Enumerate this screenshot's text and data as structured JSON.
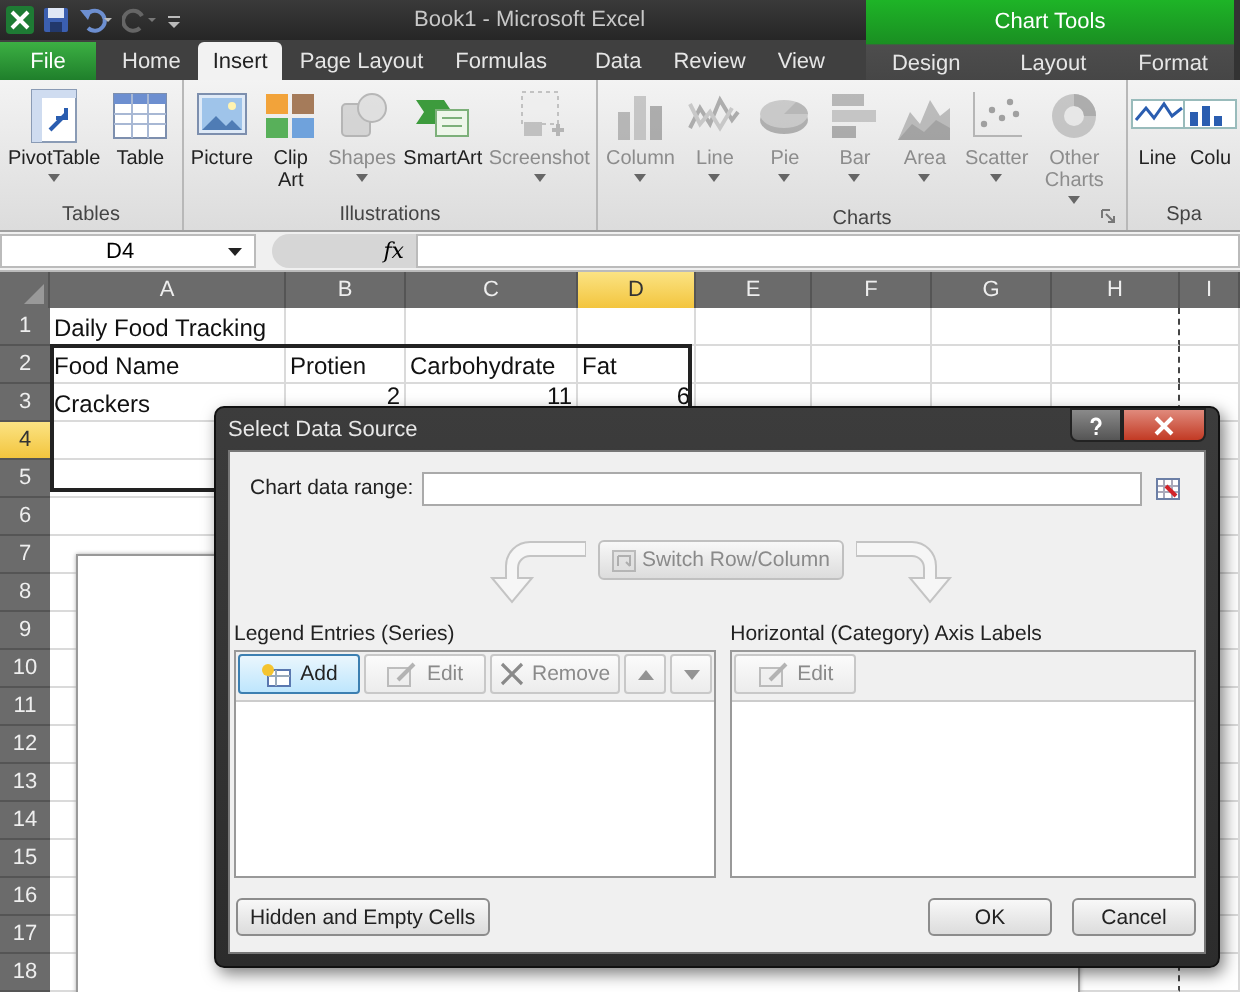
{
  "title_bar": {
    "title": "Book1 - Microsoft Excel",
    "contextual_title": "Chart Tools"
  },
  "tabs": [
    {
      "label": "File",
      "kind": "file",
      "selected": false
    },
    {
      "label": "Home",
      "kind": "normal",
      "selected": false
    },
    {
      "label": "Insert",
      "kind": "normal",
      "selected": true
    },
    {
      "label": "Page Layout",
      "kind": "normal",
      "selected": false
    },
    {
      "label": "Formulas",
      "kind": "normal",
      "selected": false
    },
    {
      "label": "Data",
      "kind": "normal",
      "selected": false
    },
    {
      "label": "Review",
      "kind": "normal",
      "selected": false
    },
    {
      "label": "View",
      "kind": "normal",
      "selected": false
    },
    {
      "label": "Design",
      "kind": "contextual",
      "selected": false
    },
    {
      "label": "Layout",
      "kind": "contextual",
      "selected": false
    },
    {
      "label": "Format",
      "kind": "contextual",
      "selected": false
    }
  ],
  "ribbon_groups": [
    {
      "label": "Tables",
      "items": [
        {
          "label": "PivotTable",
          "kind": "pivot",
          "dropdown": true,
          "disabled": false
        },
        {
          "label": "Table",
          "kind": "table",
          "disabled": false
        }
      ]
    },
    {
      "label": "Illustrations",
      "items": [
        {
          "label": "Picture",
          "kind": "picture",
          "disabled": false
        },
        {
          "label": "Clip Art",
          "kind": "clipart",
          "disabled": false
        },
        {
          "label": "Shapes",
          "kind": "shapes",
          "dropdown": true,
          "disabled": true
        },
        {
          "label": "SmartArt",
          "kind": "smartart",
          "disabled": false
        },
        {
          "label": "Screenshot",
          "kind": "screenshot",
          "dropdown": true,
          "disabled": true
        }
      ]
    },
    {
      "label": "Charts",
      "launcher": true,
      "items": [
        {
          "label": "Column",
          "kind": "column",
          "dropdown": true,
          "disabled": true
        },
        {
          "label": "Line",
          "kind": "line",
          "dropdown": true,
          "disabled": true
        },
        {
          "label": "Pie",
          "kind": "pie",
          "dropdown": true,
          "disabled": true
        },
        {
          "label": "Bar",
          "kind": "bar",
          "dropdown": true,
          "disabled": true
        },
        {
          "label": "Area",
          "kind": "area",
          "dropdown": true,
          "disabled": true
        },
        {
          "label": "Scatter",
          "kind": "scatter",
          "dropdown": true,
          "disabled": true
        },
        {
          "label": "Other Charts",
          "kind": "other",
          "dropdown": true,
          "disabled": true
        }
      ]
    },
    {
      "label": "Spa",
      "items": [
        {
          "label": "Line",
          "kind": "sparkline",
          "disabled": false
        },
        {
          "label": "Colu",
          "kind": "sparkcolumn",
          "disabled": false
        }
      ]
    }
  ],
  "formula_bar": {
    "name_box": "D4",
    "function_label": "fx"
  },
  "sheet": {
    "columns": [
      {
        "label": "A",
        "selected": false
      },
      {
        "label": "B",
        "selected": false
      },
      {
        "label": "C",
        "selected": false
      },
      {
        "label": "D",
        "selected": true
      },
      {
        "label": "E",
        "selected": false
      },
      {
        "label": "F",
        "selected": false
      },
      {
        "label": "G",
        "selected": false
      },
      {
        "label": "H",
        "selected": false
      },
      {
        "label": "I",
        "selected": false
      }
    ],
    "rows": [
      {
        "label": "1",
        "selected": false,
        "cells": [
          {
            "text": "Daily Food Tracking",
            "kind": "text"
          }
        ]
      },
      {
        "label": "2",
        "selected": false,
        "cells": [
          {
            "text": "Food Name",
            "kind": "text"
          },
          {
            "text": "Protien",
            "kind": "text"
          },
          {
            "text": "Carbohydrate",
            "kind": "text"
          },
          {
            "text": "Fat",
            "kind": "text"
          }
        ]
      },
      {
        "label": "3",
        "selected": false,
        "cells": [
          {
            "text": "Crackers",
            "kind": "text"
          },
          {
            "text": "2",
            "kind": "number"
          },
          {
            "text": "11",
            "kind": "number"
          },
          {
            "text": "6",
            "kind": "number"
          }
        ]
      },
      {
        "label": "4",
        "selected": true,
        "cells": []
      },
      {
        "label": "5",
        "selected": false,
        "cells": []
      },
      {
        "label": "6",
        "selected": false,
        "cells": []
      },
      {
        "label": "7",
        "selected": false,
        "cells": []
      },
      {
        "label": "8",
        "selected": false,
        "cells": []
      },
      {
        "label": "9",
        "selected": false,
        "cells": []
      },
      {
        "label": "10",
        "selected": false,
        "cells": []
      },
      {
        "label": "11",
        "selected": false,
        "cells": []
      },
      {
        "label": "12",
        "selected": false,
        "cells": []
      },
      {
        "label": "13",
        "selected": false,
        "cells": []
      },
      {
        "label": "14",
        "selected": false,
        "cells": []
      },
      {
        "label": "15",
        "selected": false,
        "cells": []
      },
      {
        "label": "16",
        "selected": false,
        "cells": []
      },
      {
        "label": "17",
        "selected": false,
        "cells": []
      },
      {
        "label": "18",
        "selected": false,
        "cells": []
      }
    ]
  },
  "dialog": {
    "title": "Select Data Source",
    "range_label": "Chart data range:",
    "switch_button": {
      "label": "Switch Row/Column",
      "disabled": true
    },
    "legend": {
      "label": "Legend Entries (Series)",
      "buttons": [
        {
          "label": "Add",
          "kind": "add",
          "disabled": false,
          "focused": true
        },
        {
          "label": "Edit",
          "kind": "edit",
          "disabled": true,
          "focused": false
        },
        {
          "label": "Remove",
          "kind": "remove",
          "disabled": true,
          "focused": false
        },
        {
          "kind": "up",
          "disabled": true,
          "focused": false
        },
        {
          "kind": "down",
          "disabled": true,
          "focused": false
        }
      ]
    },
    "axis": {
      "label": "Horizontal (Category) Axis Labels",
      "buttons": [
        {
          "label": "Edit",
          "kind": "edit",
          "disabled": true,
          "focused": false
        }
      ]
    },
    "footer_buttons": [
      {
        "label": "Hidden and Empty Cells",
        "kind": "left"
      },
      {
        "label": "OK",
        "kind": "right"
      },
      {
        "label": "Cancel",
        "kind": "right"
      }
    ]
  }
}
